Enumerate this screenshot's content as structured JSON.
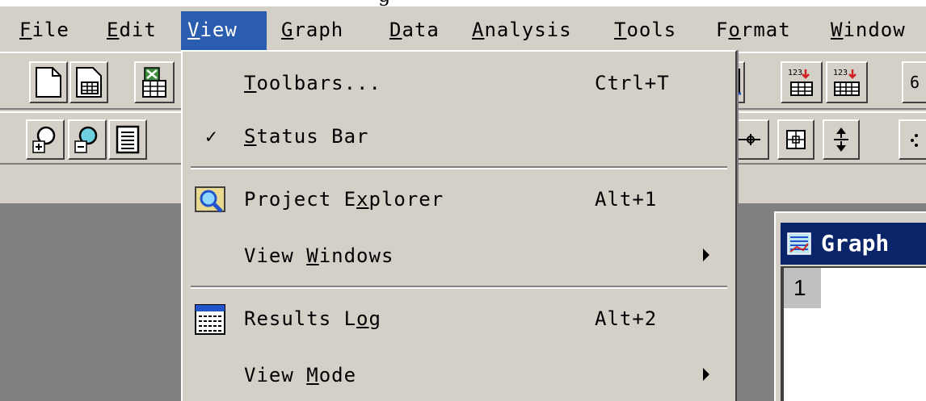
{
  "window_title_fragment": "g",
  "menubar": {
    "items": [
      {
        "pre": "",
        "ul": "F",
        "post": "ile"
      },
      {
        "pre": "",
        "ul": "E",
        "post": "dit"
      },
      {
        "pre": "",
        "ul": "V",
        "post": "iew"
      },
      {
        "pre": "",
        "ul": "G",
        "post": "raph"
      },
      {
        "pre": "",
        "ul": "D",
        "post": "ata"
      },
      {
        "pre": "",
        "ul": "A",
        "post": "nalysis"
      },
      {
        "pre": "",
        "ul": "T",
        "post": "ools"
      },
      {
        "pre": "F",
        "ul": "o",
        "post": "rmat"
      },
      {
        "pre": "",
        "ul": "W",
        "post": "indow"
      }
    ],
    "active_index": 2
  },
  "view_menu": {
    "toolbars": {
      "pre": "",
      "ul": "T",
      "post": "oolbars...",
      "shortcut": "Ctrl+T"
    },
    "status_bar": {
      "check": "✓",
      "pre": "",
      "ul": "S",
      "post": "tatus Bar"
    },
    "project_explorer": {
      "pre": "Project E",
      "ul": "x",
      "post": "plorer",
      "shortcut": "Alt+1"
    },
    "view_windows": {
      "pre": "View ",
      "ul": "W",
      "post": "indows"
    },
    "results_log": {
      "pre": "Results L",
      "ul": "o",
      "post": "g",
      "shortcut": "Alt+2"
    },
    "view_mode": {
      "pre": "View ",
      "ul": "M",
      "post": "ode"
    }
  },
  "graph_window": {
    "title": "Graph",
    "layer_label": "1"
  },
  "toolbar": {
    "right_edge_glyph": "6",
    "counter_label": "123"
  },
  "colors": {
    "menu_highlight": "#2a5cb0",
    "title_bar": "#0a246a",
    "face": "#d4d0c8",
    "workspace": "#808080"
  }
}
